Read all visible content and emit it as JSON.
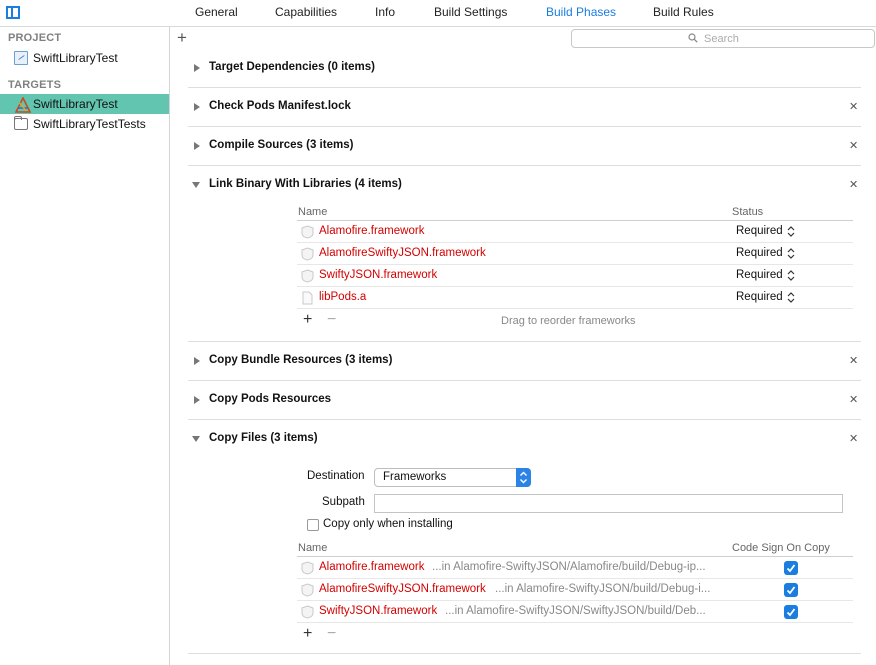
{
  "tabs": [
    "General",
    "Capabilities",
    "Info",
    "Build Settings",
    "Build Phases",
    "Build Rules"
  ],
  "active_tab": "Build Phases",
  "search": {
    "placeholder": "Search"
  },
  "sidebar": {
    "project_header": "PROJECT",
    "project_item": "SwiftLibraryTest",
    "targets_header": "TARGETS",
    "targets": [
      "SwiftLibraryTest",
      "SwiftLibraryTestTests"
    ],
    "selected_target": "SwiftLibraryTest"
  },
  "phases": {
    "target_dependencies": "Target Dependencies (0 items)",
    "check_pods": "Check Pods Manifest.lock",
    "compile_sources": "Compile Sources (3 items)",
    "link_binary": "Link Binary With Libraries (4 items)",
    "copy_bundle": "Copy Bundle Resources (3 items)",
    "copy_pods": "Copy Pods Resources",
    "copy_files": "Copy Files (3 items)"
  },
  "link_table": {
    "col_name": "Name",
    "col_status": "Status",
    "rows": [
      {
        "name": "Alamofire.framework",
        "status": "Required",
        "icon": "framework-icon"
      },
      {
        "name": "AlamofireSwiftyJSON.framework",
        "status": "Required",
        "icon": "framework-icon"
      },
      {
        "name": "SwiftyJSON.framework",
        "status": "Required",
        "icon": "framework-icon"
      },
      {
        "name": "libPods.a",
        "status": "Required",
        "icon": "file-icon"
      }
    ],
    "hint": "Drag to reorder frameworks"
  },
  "copy_files": {
    "destination_label": "Destination",
    "destination_value": "Frameworks",
    "subpath_label": "Subpath",
    "subpath_value": "",
    "copy_only_label": "Copy only when installing",
    "col_name": "Name",
    "col_codesign": "Code Sign On Copy",
    "rows": [
      {
        "name": "Alamofire.framework",
        "path": "...in Alamofire-SwiftyJSON/Alamofire/build/Debug-ip...",
        "codesign": true
      },
      {
        "name": "AlamofireSwiftyJSON.framework",
        "path": "...in Alamofire-SwiftyJSON/build/Debug-i...",
        "codesign": true
      },
      {
        "name": "SwiftyJSON.framework",
        "path": "...in Alamofire-SwiftyJSON/SwiftyJSON/build/Deb...",
        "codesign": true
      }
    ]
  },
  "colors": {
    "accent": "#1a7de0",
    "selection": "#62c5b0",
    "missing_file": "#d30000"
  }
}
